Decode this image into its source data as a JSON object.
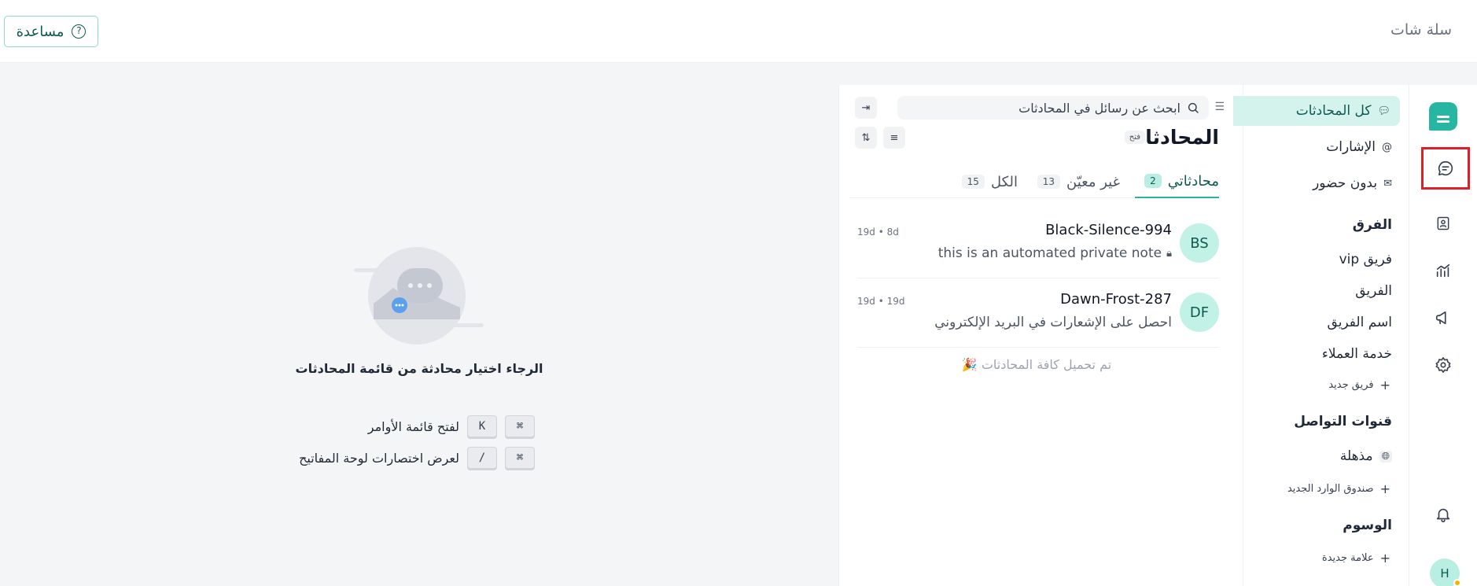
{
  "header": {
    "brand": "سلة شات",
    "help_label": "مساعدة",
    "help_icon": "?"
  },
  "nav": {
    "all_conversations": "كل المحادثات",
    "mentions": "الإشارات",
    "unattended": "بدون حضور",
    "teams_section": "الفرق",
    "team_vip": "فريق vip",
    "team": "الفريق",
    "team_name": "اسم الفريق",
    "customer_service": "خدمة العملاء",
    "new_team": "فريق جديد",
    "channels_section": "قنوات التواصل",
    "channel_amazing": "مذهلة",
    "new_inbox": "صندوق الوارد الجديد",
    "labels_section": "الوسوم",
    "new_label": "علامة جديدة"
  },
  "rail": {
    "avatar_initial": "H"
  },
  "conversations": {
    "search_placeholder": "ابحث عن رسائل في المحادثات",
    "title": "المحادثات",
    "title_badge": "فتح",
    "tabs": [
      {
        "label": "محادثاتي",
        "count": "2"
      },
      {
        "label": "غير معيّن",
        "count": "13"
      },
      {
        "label": "الكل",
        "count": "15"
      }
    ],
    "items": [
      {
        "initials": "BS",
        "name": "Black-Silence-994",
        "message": "this is an automated private note",
        "time": "19d • 8d"
      },
      {
        "initials": "DF",
        "name": "Dawn-Frost-287",
        "message": "احصل على الإشعارات في البريد الإلكتروني",
        "time": "19d • 19d"
      }
    ],
    "all_loaded": "تم تحميل كافة المحادثات",
    "all_loaded_emoji": "🎉"
  },
  "main": {
    "empty_text": "الرجاء اختيار محادثة من قائمة المحادثات",
    "shortcuts": [
      {
        "keys": [
          "⌘",
          "K"
        ],
        "label": "لفتح قائمة الأوامر"
      },
      {
        "keys": [
          "⌘",
          "/"
        ],
        "label": "لعرض اختصارات لوحة المفاتيح"
      }
    ]
  },
  "colors": {
    "accent": "#26b6a1",
    "accent_light": "#d3f3ec",
    "highlight_box": "#e11d2a"
  }
}
